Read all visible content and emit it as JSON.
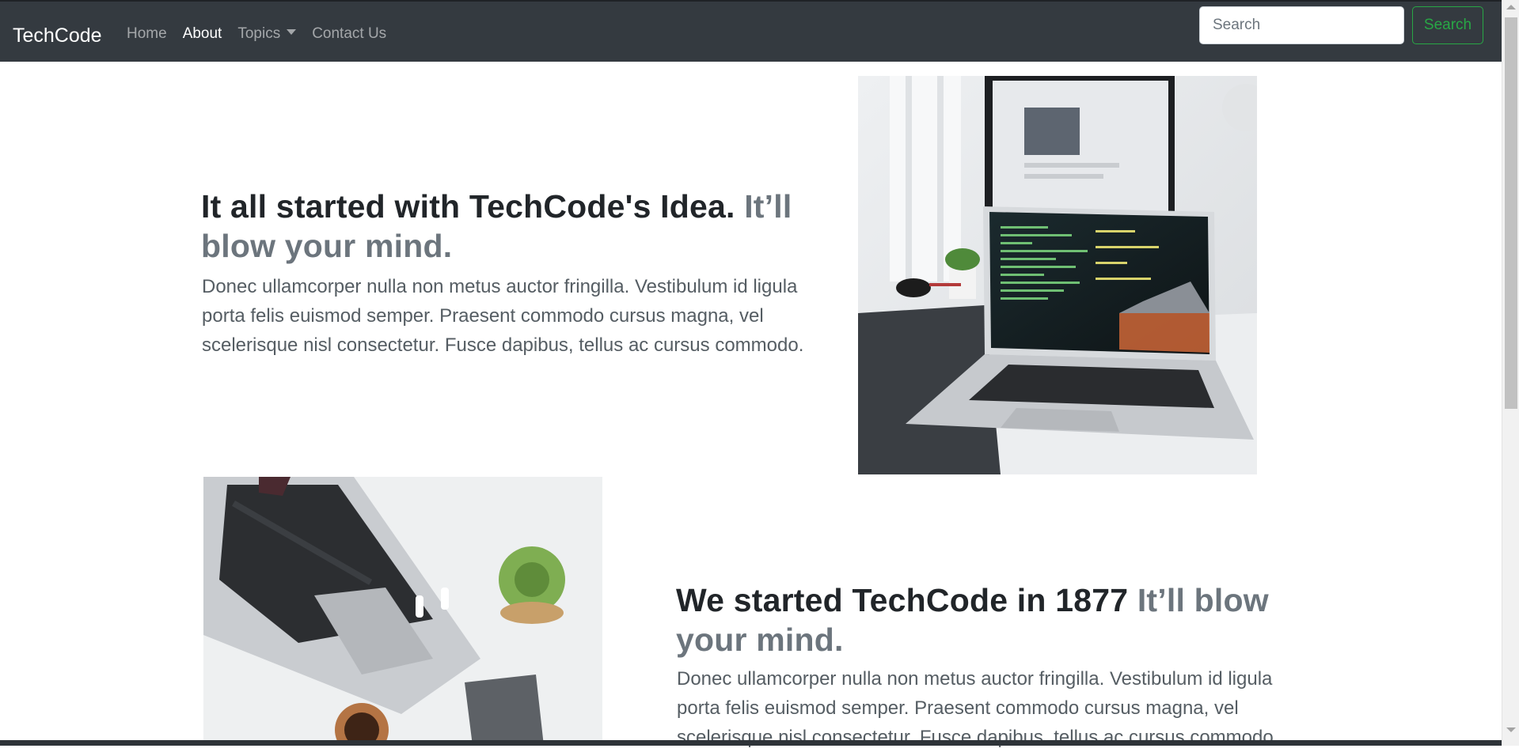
{
  "navbar": {
    "brand": "TechCode",
    "links": [
      {
        "label": "Home"
      },
      {
        "label": "About"
      },
      {
        "label": "Topics"
      },
      {
        "label": "Contact Us"
      }
    ],
    "search_placeholder": "Search",
    "search_button": "Search"
  },
  "features": [
    {
      "heading": "It all started with TechCode's Idea.",
      "heading_muted": "It’ll blow your mind.",
      "lead": "Donec ullamcorper nulla non metus auctor fringilla. Vestibulum id ligula porta felis euismod semper. Praesent commodo cursus magna, vel scelerisque nisl consectetur. Fusce dapibus, tellus ac cursus commodo."
    },
    {
      "heading": "We started TechCode in 1877",
      "heading_muted": "It’ll blow your mind.",
      "lead": "Donec ullamcorper nulla non metus auctor fringilla. Vestibulum id ligula porta felis euismod semper. Praesent commodo cursus magna, vel scelerisque nisl consectetur. Fusce dapibus, tellus ac cursus commodo."
    }
  ],
  "colors": {
    "navbar_bg": "#343a40",
    "search_accent": "#28a745",
    "muted_text": "#6c757d"
  }
}
